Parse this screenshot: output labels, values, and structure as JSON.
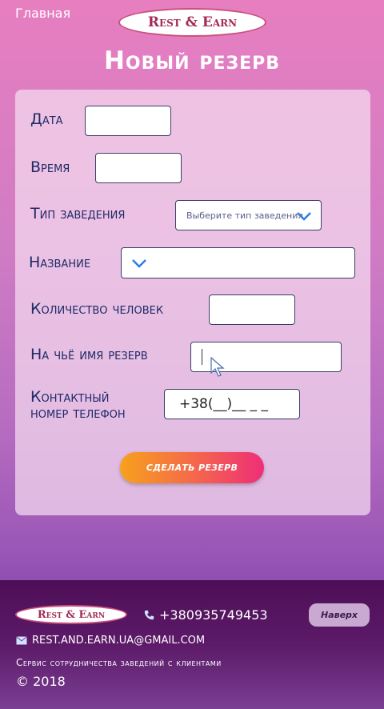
{
  "header": {
    "home_link": "Главная",
    "logo_text": "Rest & Earn"
  },
  "page": {
    "title": "Новый резерв"
  },
  "form": {
    "date_label": "Дата",
    "time_label": "Время",
    "type_label": "Тип заведения",
    "type_placeholder": "Выберите тип заведения",
    "name_label": "Название",
    "people_label": "Количество человек",
    "reserve_name_label": "На чьё имя резерв",
    "phone_label_1": "Контактный",
    "phone_label_2": "номер телефон",
    "phone_value": "+38(__)__ _ _",
    "submit_label": "Сделать резерв"
  },
  "footer": {
    "logo_text": "Rest & Earn",
    "phone": "+380935749453",
    "top_button": "Наверх",
    "email": "REST.AND.EARN.UA@GMAIL.COM",
    "tagline": "Сервис сотрудничества заведений с клиентами",
    "copyright": "© 2018"
  },
  "colors": {
    "accent_start": "#f7a11c",
    "accent_end": "#ee2e77",
    "label": "#1f2a66",
    "footer_bg": "#4e0f57"
  },
  "icons": {
    "select_chevron": "chevron-down-icon",
    "phone": "phone-icon",
    "email": "envelope-icon"
  }
}
